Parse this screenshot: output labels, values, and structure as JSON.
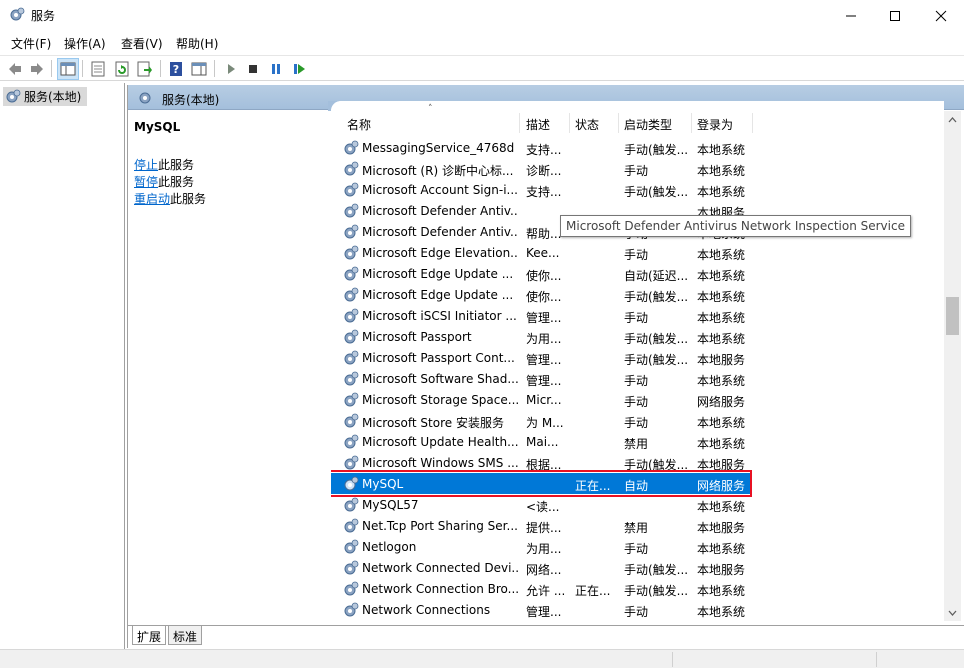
{
  "window": {
    "title": "服务",
    "minimize_icon": "minimize-icon",
    "maximize_icon": "maximize-icon",
    "close_icon": "close-icon"
  },
  "menu": [
    "文件(F)",
    "操作(A)",
    "查看(V)",
    "帮助(H)"
  ],
  "toolbar": {
    "buttons": [
      "back-arrow-icon",
      "forward-arrow-icon",
      "show-hide-console-tree-icon",
      "properties-icon",
      "refresh-icon",
      "export-list-icon",
      "help-icon",
      "show-hide-action-pane-icon",
      "start-service-icon",
      "stop-service-icon",
      "pause-service-icon",
      "restart-service-icon"
    ]
  },
  "tree": {
    "item": "服务(本地)"
  },
  "main": {
    "header": "服务(本地)",
    "detail": {
      "title": "MySQL",
      "stop_link": "停止",
      "stop_suffix": "此服务",
      "pause_link": "暂停",
      "pause_suffix": "此服务",
      "restart_link": "重启动",
      "restart_suffix": "此服务"
    },
    "columns": {
      "name": "名称",
      "desc": "描述",
      "status": "状态",
      "start": "启动类型",
      "logon": "登录为"
    },
    "tooltip": "Microsoft Defender Antivirus Network Inspection Service",
    "rows": [
      {
        "name": "MessagingService_4768d",
        "desc": "支持...",
        "status": "",
        "start": "手动(触发...",
        "logon": "本地系统"
      },
      {
        "name": "Microsoft (R) 诊断中心标...",
        "desc": "诊断...",
        "status": "",
        "start": "手动",
        "logon": "本地系统"
      },
      {
        "name": "Microsoft Account Sign-i...",
        "desc": "支持...",
        "status": "",
        "start": "手动(触发...",
        "logon": "本地系统"
      },
      {
        "name": "Microsoft Defender Antiv...",
        "desc": "",
        "status": "",
        "start": "",
        "logon": "本地服务"
      },
      {
        "name": "Microsoft Defender Antiv...",
        "desc": "帮助...",
        "status": "",
        "start": "手动",
        "logon": "本地系统"
      },
      {
        "name": "Microsoft Edge Elevation...",
        "desc": "Kee...",
        "status": "",
        "start": "手动",
        "logon": "本地系统"
      },
      {
        "name": "Microsoft Edge Update ...",
        "desc": "使你...",
        "status": "",
        "start": "自动(延迟...",
        "logon": "本地系统"
      },
      {
        "name": "Microsoft Edge Update ...",
        "desc": "使你...",
        "status": "",
        "start": "手动(触发...",
        "logon": "本地系统"
      },
      {
        "name": "Microsoft iSCSI Initiator ...",
        "desc": "管理...",
        "status": "",
        "start": "手动",
        "logon": "本地系统"
      },
      {
        "name": "Microsoft Passport",
        "desc": "为用...",
        "status": "",
        "start": "手动(触发...",
        "logon": "本地系统"
      },
      {
        "name": "Microsoft Passport Cont...",
        "desc": "管理...",
        "status": "",
        "start": "手动(触发...",
        "logon": "本地服务"
      },
      {
        "name": "Microsoft Software Shad...",
        "desc": "管理...",
        "status": "",
        "start": "手动",
        "logon": "本地系统"
      },
      {
        "name": "Microsoft Storage Space...",
        "desc": "Micr...",
        "status": "",
        "start": "手动",
        "logon": "网络服务"
      },
      {
        "name": "Microsoft Store 安装服务",
        "desc": "为 M...",
        "status": "",
        "start": "手动",
        "logon": "本地系统"
      },
      {
        "name": "Microsoft Update Health...",
        "desc": "Mai...",
        "status": "",
        "start": "禁用",
        "logon": "本地系统"
      },
      {
        "name": "Microsoft Windows SMS ...",
        "desc": "根据...",
        "status": "",
        "start": "手动(触发...",
        "logon": "本地服务"
      },
      {
        "name": "MySQL",
        "desc": "",
        "status": "正在...",
        "start": "自动",
        "logon": "网络服务"
      },
      {
        "name": "MySQL57",
        "desc": "<读...",
        "status": "",
        "start": "",
        "logon": "本地系统"
      },
      {
        "name": "Net.Tcp Port Sharing Ser...",
        "desc": "提供...",
        "status": "",
        "start": "禁用",
        "logon": "本地服务"
      },
      {
        "name": "Netlogon",
        "desc": "为用...",
        "status": "",
        "start": "手动",
        "logon": "本地系统"
      },
      {
        "name": "Network Connected Devi...",
        "desc": "网络...",
        "status": "",
        "start": "手动(触发...",
        "logon": "本地服务"
      },
      {
        "name": "Network Connection Bro...",
        "desc": "允许 ...",
        "status": "正在...",
        "start": "手动(触发...",
        "logon": "本地系统"
      },
      {
        "name": "Network Connections",
        "desc": "管理...",
        "status": "",
        "start": "手动",
        "logon": "本地系统"
      }
    ],
    "selected_row": 16,
    "tabs": [
      "扩展",
      "标准"
    ]
  },
  "colors": {
    "selected_bg": "#0078d7",
    "highlight_border": "#e81123",
    "header_bg": "#a4bfdc",
    "link": "#0066cc"
  }
}
